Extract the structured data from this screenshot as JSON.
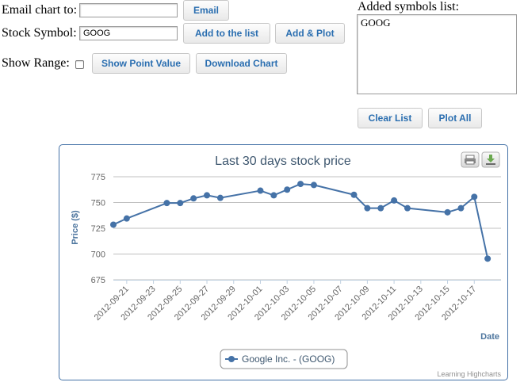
{
  "form": {
    "email_label": "Email chart to:",
    "email_value": "",
    "email_button": "Email",
    "symbol_label": "Stock Symbol:",
    "symbol_value": "GOOG",
    "add_button": "Add to the list",
    "add_plot_button": "Add & Plot",
    "range_label": "Show Range:",
    "range_checked": false,
    "point_value_button": "Show Point Value",
    "download_button": "Download Chart"
  },
  "symbols": {
    "label": "Added symbols list:",
    "items": [
      "GOOG"
    ],
    "clear_button": "Clear List",
    "plot_all_button": "Plot All"
  },
  "chart_toolbar": {
    "print_icon": "print-icon",
    "export_icon": "download-icon"
  },
  "chart_data": {
    "type": "line",
    "title": "Last 30 days stock price",
    "ylabel": "Price ($)",
    "xlabel": "Date",
    "ylim": [
      675,
      775
    ],
    "yticks": [
      675,
      700,
      725,
      750,
      775
    ],
    "xlim": [
      "2012-09-20",
      "2012-10-19"
    ],
    "xticks": [
      "2012-09-21",
      "2012-09-23",
      "2012-09-25",
      "2012-09-27",
      "2012-09-29",
      "2012-10-01",
      "2012-10-03",
      "2012-10-05",
      "2012-10-07",
      "2012-10-09",
      "2012-10-11",
      "2012-10-13",
      "2012-10-15",
      "2012-10-17"
    ],
    "grid": true,
    "legend": "bottom-center",
    "credits": "Learning Highcharts",
    "color": "#4572a7",
    "series": [
      {
        "name": "Google Inc. - (GOOG)",
        "x": [
          "2012-09-20",
          "2012-09-21",
          "2012-09-24",
          "2012-09-25",
          "2012-09-26",
          "2012-09-27",
          "2012-09-28",
          "2012-10-01",
          "2012-10-02",
          "2012-10-03",
          "2012-10-04",
          "2012-10-05",
          "2012-10-08",
          "2012-10-09",
          "2012-10-10",
          "2012-10-11",
          "2012-10-12",
          "2012-10-15",
          "2012-10-16",
          "2012-10-17",
          "2012-10-18"
        ],
        "values": [
          728.5,
          734.5,
          749.5,
          749.5,
          754,
          757,
          754.5,
          761.5,
          757,
          762.5,
          768,
          767,
          757.5,
          744.5,
          744.5,
          752,
          744.5,
          740.5,
          744.5,
          755.5,
          695.5
        ]
      }
    ]
  }
}
